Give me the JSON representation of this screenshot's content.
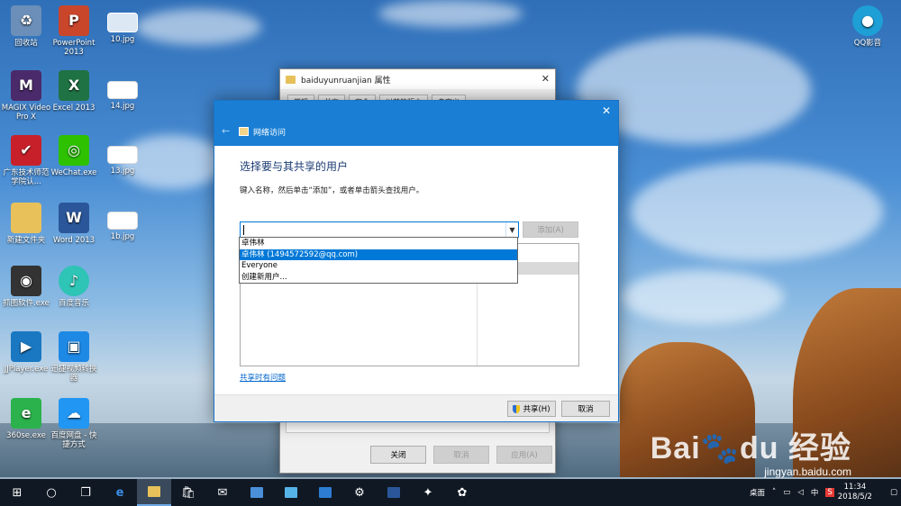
{
  "desktop": {
    "icons_col1": [
      {
        "label": "回收站",
        "icon": "recycle-bin-icon",
        "color": "#6b8fb8"
      },
      {
        "label": "MAGIX Video Pro X",
        "icon": "magix-icon",
        "color": "#4a2a6a"
      },
      {
        "label": "广东技术师范学院认...",
        "icon": "app-icon",
        "color": "#c8202a"
      },
      {
        "label": "新建文件夹",
        "icon": "folder-icon",
        "color": "#e8c15a"
      },
      {
        "label": "抓图软件.exe",
        "icon": "camera-icon",
        "color": "#333333"
      },
      {
        "label": "JJPlayer.exe",
        "icon": "player-icon",
        "color": "#1a78c2"
      },
      {
        "label": "360se.exe",
        "icon": "browser-360-icon",
        "color": "#2bb24c"
      }
    ],
    "icons_col2": [
      {
        "label": "PowerPoint 2013",
        "icon": "powerpoint-icon",
        "color": "#c9462b"
      },
      {
        "label": "Excel 2013",
        "icon": "excel-icon",
        "color": "#1f7244"
      },
      {
        "label": "WeChat.exe",
        "icon": "wechat-icon",
        "color": "#2dc100"
      },
      {
        "label": "Word 2013",
        "icon": "word-icon",
        "color": "#2b579a"
      },
      {
        "label": "百度音乐",
        "icon": "music-icon",
        "color": "#2ec4b6"
      },
      {
        "label": "迅捷视频转换器",
        "icon": "video-converter-icon",
        "color": "#1e88e5"
      },
      {
        "label": "百度网盘 - 快捷方式",
        "icon": "cloud-drive-icon",
        "color": "#2196f3"
      }
    ],
    "icons_col3": [
      {
        "label": "10.jpg"
      },
      {
        "label": "14.jpg"
      },
      {
        "label": "13.jpg"
      },
      {
        "label": "1b.jpg"
      }
    ],
    "qq_icon_label": "QQ影音"
  },
  "back_window": {
    "title": "baiduyunruanjian 属性",
    "tabs": [
      "常规",
      "共享",
      "安全",
      "以前的版本",
      "自定义"
    ],
    "buttons": {
      "close": "关闭",
      "cancel": "取消",
      "apply": "应用(A)"
    }
  },
  "dialog": {
    "header_title": "网络访问",
    "heading": "选择要与其共享的用户",
    "description": "键入名称，然后单击“添加”，或者单击箭头查找用户。",
    "input_value": "",
    "add_button": "添加(A)",
    "dropdown_options": [
      "卓伟林",
      "卓伟林 (1494572592@qq.com)",
      "Everyone",
      "创建新用户..."
    ],
    "selected_option_index": 1,
    "help_link": "共享时有问题",
    "share_button": "共享(H)",
    "cancel_button": "取消"
  },
  "taskbar": {
    "desktop_label": "桌面",
    "ime_label": "中",
    "time": "11:34",
    "date": "2018/5/2"
  },
  "watermark": {
    "brand": "Bai",
    "brand2": "du",
    "brand3": "经验",
    "url": "jingyan.baidu.com"
  }
}
